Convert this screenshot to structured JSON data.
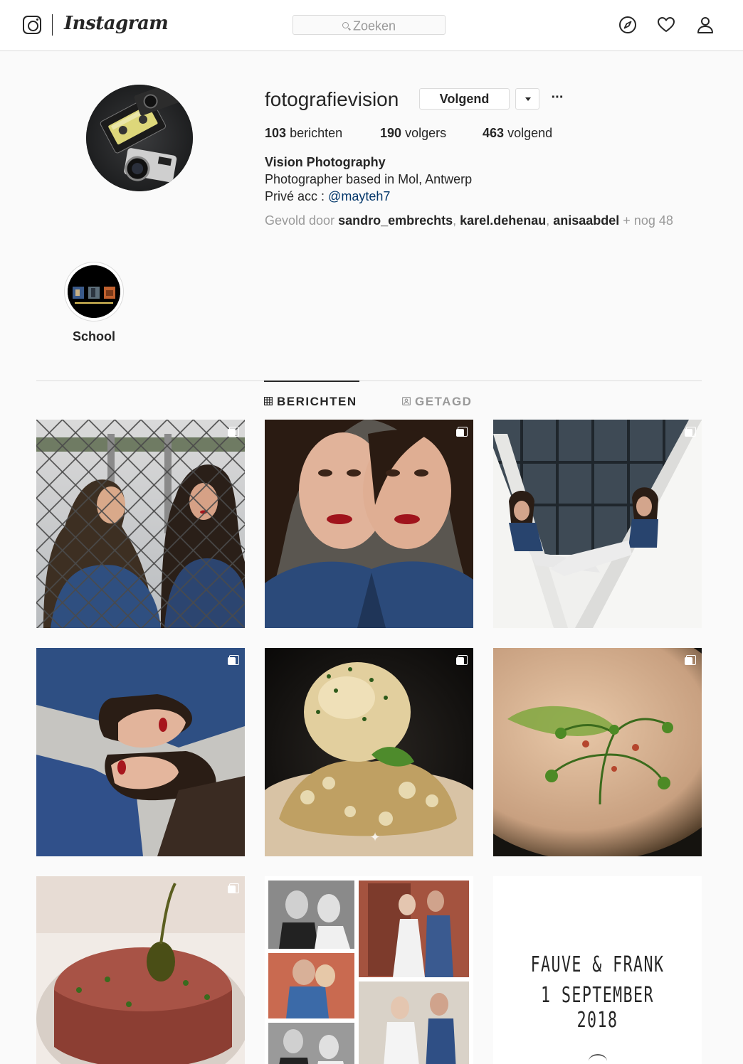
{
  "nav": {
    "logo_icon": "instagram-camera-icon",
    "wordmark": "Instagram",
    "search_placeholder": "Zoeken",
    "icons": [
      "compass-icon",
      "heart-icon",
      "profile-icon"
    ]
  },
  "profile": {
    "username": "fotografievision",
    "follow_button": "Volgend",
    "more_icon": "ellipsis-icon",
    "stats": {
      "posts_count": "103",
      "posts_label": "berichten",
      "followers_count": "190",
      "followers_label": "volgers",
      "following_count": "463",
      "following_label": "volgend"
    },
    "full_name": "Vision Photography",
    "bio_line1": "Photographer based in Mol, Antwerp",
    "bio_line2_prefix": "Privé acc :",
    "bio_mention": "@mayteh7",
    "followed_by_prefix": "Gevold door",
    "followed_by_users": [
      "sandro_embrechts",
      "karel.dehenau",
      "anisaabdel"
    ],
    "followed_by_suffix": "+ nog 48"
  },
  "highlights": [
    {
      "label": "School"
    }
  ],
  "tabs": {
    "posts": "BERICHTEN",
    "tagged": "GETAGD",
    "active": "posts"
  },
  "posts": {
    "items": [
      {
        "subject": "two women in denim by chain-link fence",
        "multiple": true
      },
      {
        "subject": "close-up two women red lipstick",
        "multiple": true
      },
      {
        "subject": "two women seated on white V-shaped structure",
        "multiple": true
      },
      {
        "subject": "two women lying head to head",
        "multiple": true
      },
      {
        "subject": "ice cream scoop on crumble",
        "multiple": true
      },
      {
        "subject": "soup with chervil garnish",
        "multiple": true
      },
      {
        "subject": "steak tartare with caper berry",
        "multiple": true
      },
      {
        "subject": "black and white wedding collage",
        "multiple": false
      },
      {
        "subject": "wedding title card",
        "multiple": false,
        "card_line1": "FAUVE & FRANK",
        "card_line2": "1 SEPTEMBER 2018"
      }
    ]
  },
  "colors": {
    "border": "#dbdbdb",
    "text": "#262626",
    "muted": "#999999",
    "link": "#003569"
  }
}
